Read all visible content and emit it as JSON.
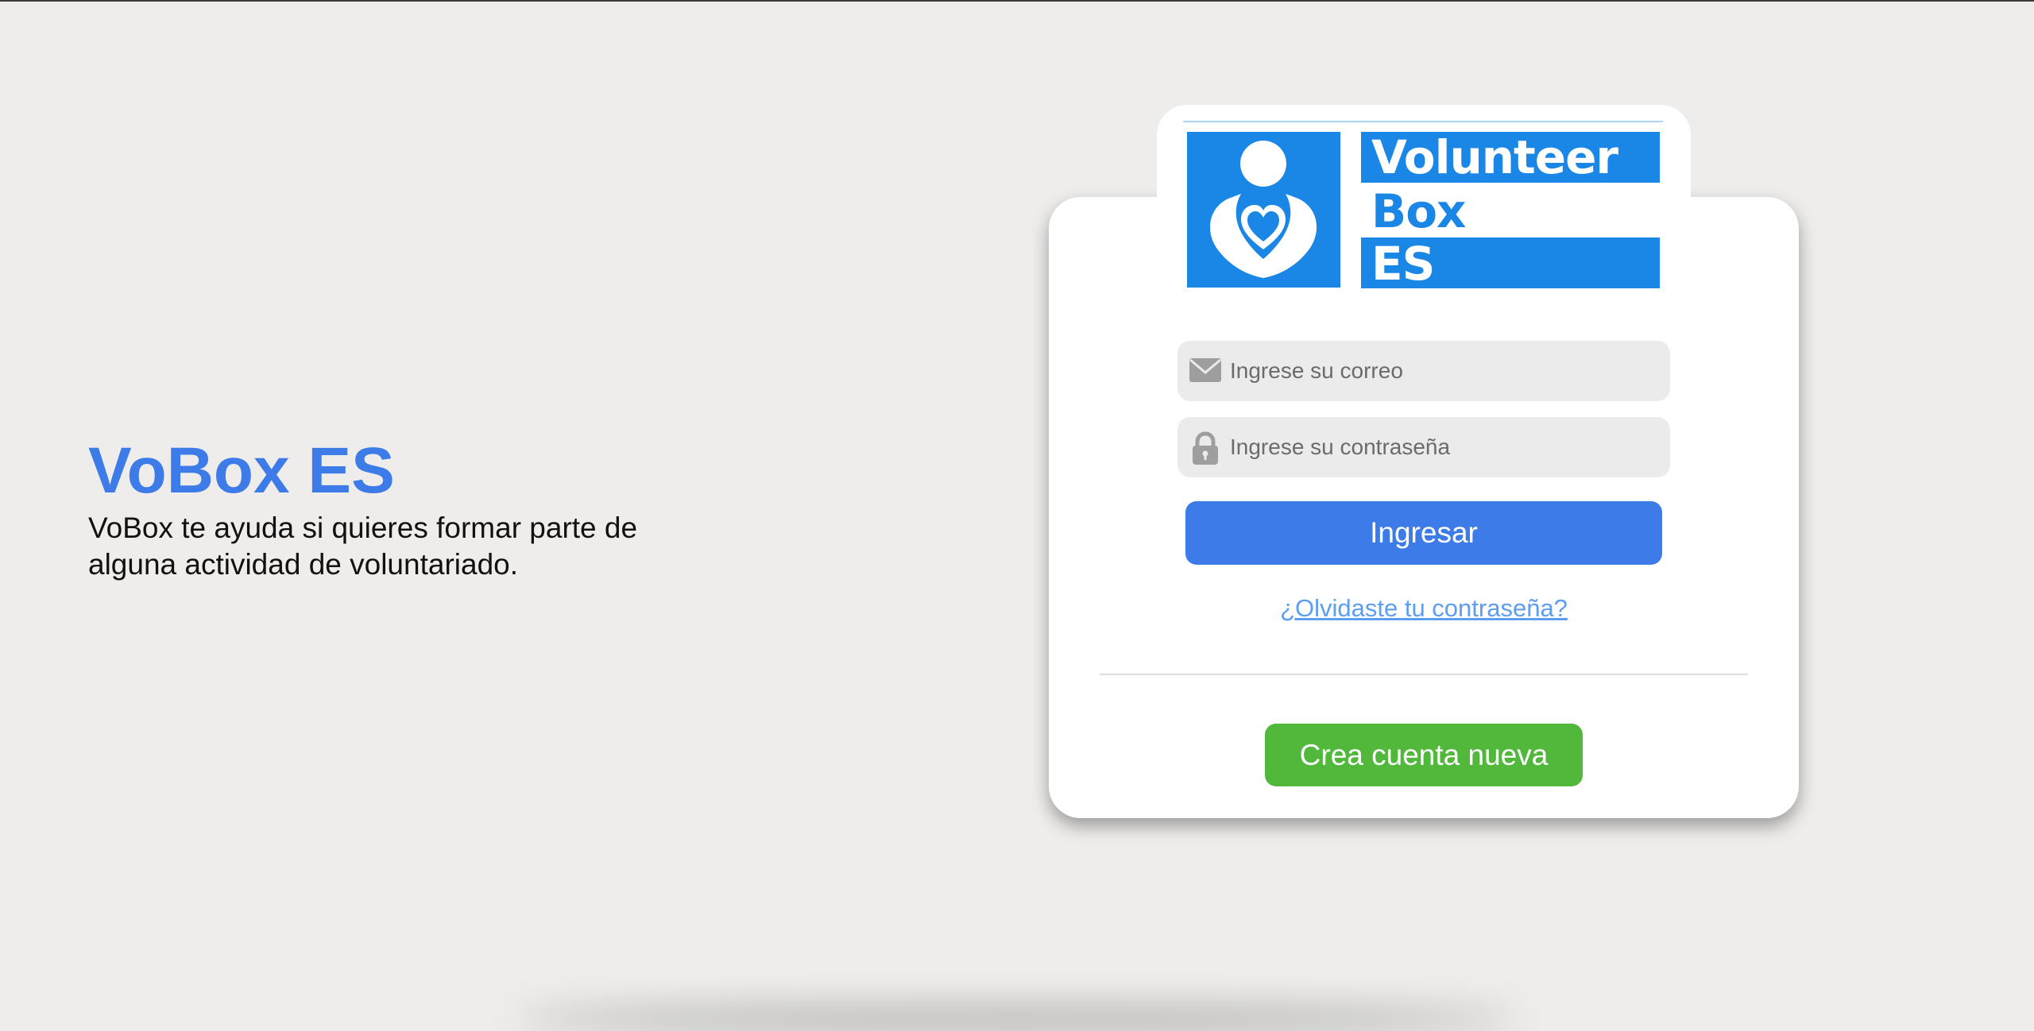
{
  "intro": {
    "title": "VoBox ES",
    "description": "VoBox te ayuda si quieres formar parte de alguna actividad de voluntariado."
  },
  "logo": {
    "line1": "Volunteer",
    "line2": "Box",
    "line3": "ES",
    "brand_color": "#1a86e6",
    "icon": "volunteer-heart-person-icon"
  },
  "login_form": {
    "email_placeholder": "Ingrese su correo",
    "email_value": "",
    "email_icon": "envelope-icon",
    "password_placeholder": "Ingrese su contraseña",
    "password_value": "",
    "password_icon": "lock-icon",
    "submit_label": "Ingresar",
    "forgot_password_label": "¿Olvidaste tu contraseña?",
    "create_account_label": "Crea cuenta nueva"
  },
  "colors": {
    "background": "#eeedeb",
    "primary": "#3d7ce8",
    "link": "#5b9ef2",
    "create_account": "#52b83c",
    "card": "#ffffff"
  }
}
